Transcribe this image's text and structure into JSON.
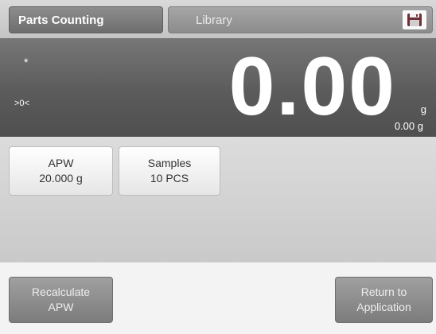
{
  "header": {
    "mode_tab": "Parts Counting",
    "library_tab": "Library",
    "save_icon": "floppy-disk-icon"
  },
  "display": {
    "stability_indicator": "*",
    "zero_indicator": ">0<",
    "main_value": "0.00",
    "main_unit": "g",
    "secondary_value": "0.00 g"
  },
  "params": {
    "apw": {
      "label": "APW",
      "value": "20.000 g"
    },
    "samples": {
      "label": "Samples",
      "value": "10 PCS"
    }
  },
  "actions": {
    "recalculate": {
      "line1": "Recalculate",
      "line2": "APW"
    },
    "return": {
      "line1": "Return to",
      "line2": "Application"
    }
  }
}
